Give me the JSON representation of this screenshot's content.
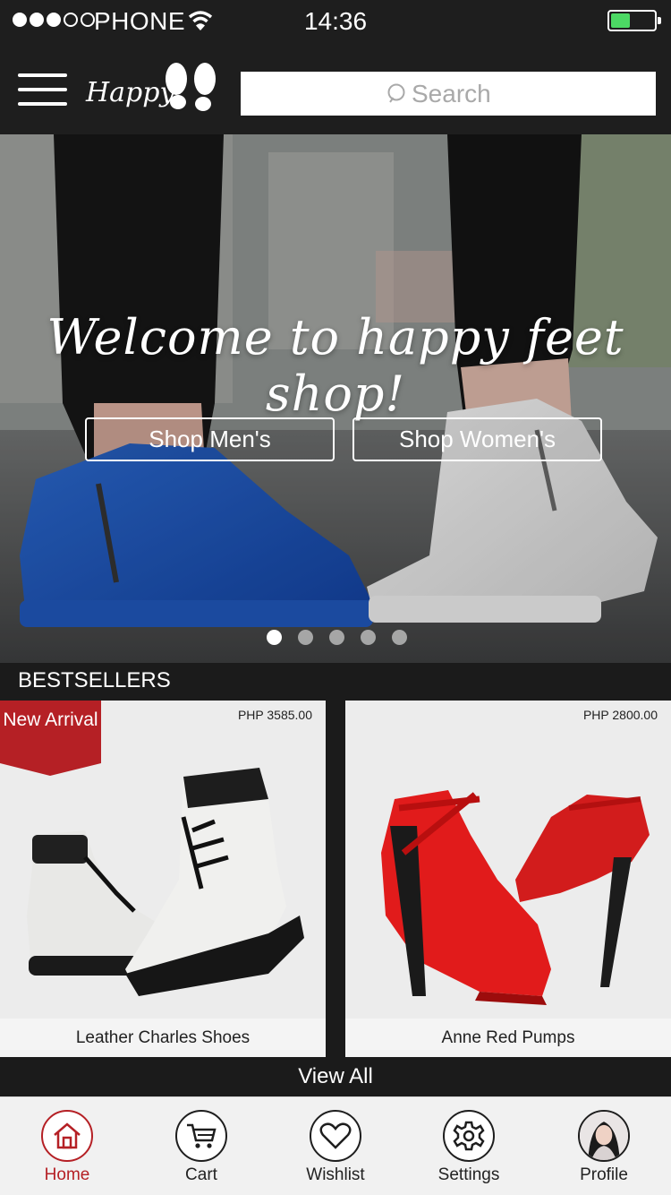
{
  "status_bar": {
    "carrier": "PHONE",
    "time": "14:36",
    "signal_bars_filled": 3,
    "signal_bars_total": 5,
    "battery_level": 0.45,
    "battery_color": "#4cd964"
  },
  "header": {
    "logo_text": "Happy",
    "search_placeholder": "Search",
    "icons": [
      "menu-icon",
      "footprints-icon",
      "search-icon"
    ]
  },
  "hero": {
    "welcome_text": "Welcome to happy feet shop!",
    "shop_mens_label": "Shop Men's",
    "shop_womens_label": "Shop Women's",
    "carousel_dots": 5,
    "active_dot": 0
  },
  "bestsellers": {
    "title": "BESTSELLERS",
    "products": [
      {
        "name": "Leather Charles Shoes",
        "price": "PHP 3585.00",
        "badge": "New Arrival"
      },
      {
        "name": "Anne Red Pumps",
        "price": "PHP 2800.00",
        "badge": ""
      }
    ],
    "view_all_label": "View All"
  },
  "tabbar": {
    "tabs": [
      {
        "label": "Home",
        "icon": "home-icon",
        "active": true
      },
      {
        "label": "Cart",
        "icon": "cart-icon",
        "active": false
      },
      {
        "label": "Wishlist",
        "icon": "heart-icon",
        "active": false
      },
      {
        "label": "Settings",
        "icon": "gear-icon",
        "active": false
      },
      {
        "label": "Profile",
        "icon": "avatar",
        "active": false
      }
    ]
  },
  "colors": {
    "accent": "#b52025",
    "dark": "#1e1e1e",
    "tab_bar_bg": "#f1f1f1"
  }
}
